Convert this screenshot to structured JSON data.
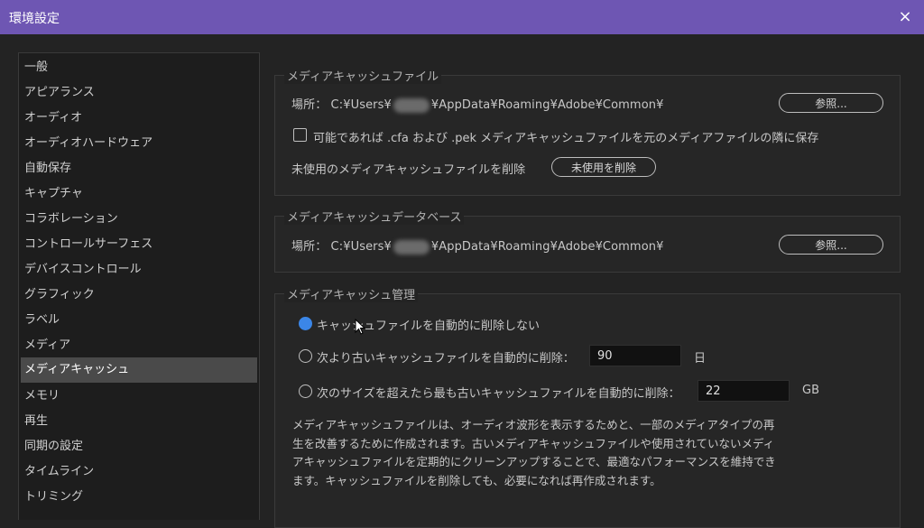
{
  "window": {
    "title": "環境設定",
    "close_icon": "×"
  },
  "sidebar": {
    "items": [
      {
        "label": "一般"
      },
      {
        "label": "アピアランス"
      },
      {
        "label": "オーディオ"
      },
      {
        "label": "オーディオハードウェア"
      },
      {
        "label": "自動保存"
      },
      {
        "label": "キャプチャ"
      },
      {
        "label": "コラボレーション"
      },
      {
        "label": "コントロールサーフェス"
      },
      {
        "label": "デバイスコントロール"
      },
      {
        "label": "グラフィック"
      },
      {
        "label": "ラベル"
      },
      {
        "label": "メディア"
      },
      {
        "label": "メディアキャッシュ"
      },
      {
        "label": "メモリ"
      },
      {
        "label": "再生"
      },
      {
        "label": "同期の設定"
      },
      {
        "label": "タイムライン"
      },
      {
        "label": "トリミング"
      }
    ],
    "selected": "メディアキャッシュ"
  },
  "cache_files": {
    "title": "メディアキャッシュファイル",
    "location_label": "場所：",
    "path_prefix": "C:¥Users¥",
    "path_suffix": "¥AppData¥Roaming¥Adobe¥Common¥",
    "browse_label": "参照...",
    "save_next_checkbox": {
      "label": "可能であれば .cfa および .pek メディアキャッシュファイルを元のメディアファイルの隣に保存",
      "checked": false
    },
    "delete_unused_label": "未使用のメディアキャッシュファイルを削除",
    "delete_unused_button": "未使用を削除"
  },
  "cache_db": {
    "title": "メディアキャッシュデータベース",
    "location_label": "場所：",
    "path_prefix": "C:¥Users¥",
    "path_suffix": "¥AppData¥Roaming¥Adobe¥Common¥",
    "browse_label": "参照..."
  },
  "cache_mgmt": {
    "title": "メディアキャッシュ管理",
    "option_none": "キャッシュファイルを自動的に削除しない",
    "option_older": "次より古いキャッシュファイルを自動的に削除：",
    "older_value": "90",
    "older_unit": "日",
    "option_size": "次のサイズを超えたら最も古いキャッシュファイルを自動的に削除：",
    "size_value": "22",
    "size_unit": "GB",
    "selected_option": "option_none",
    "description": "メディアキャッシュファイルは、オーディオ波形を表示するためと、一部のメディアタイプの再生を改善するために作成されます。古いメディアキャッシュファイルや使用されていないメディアキャッシュファイルを定期的にクリーンアップすることで、最適なパフォーマンスを維持できます。キャッシュファイルを削除しても、必要になれば再作成されます。"
  },
  "colors": {
    "titlebar": "#6e56b3",
    "accent_radio": "#3b86e8",
    "background": "#232323",
    "sidebar_selected": "#4a4a4a"
  },
  "icons": {
    "close": "close-icon",
    "cursor": "mouse-pointer-icon"
  }
}
